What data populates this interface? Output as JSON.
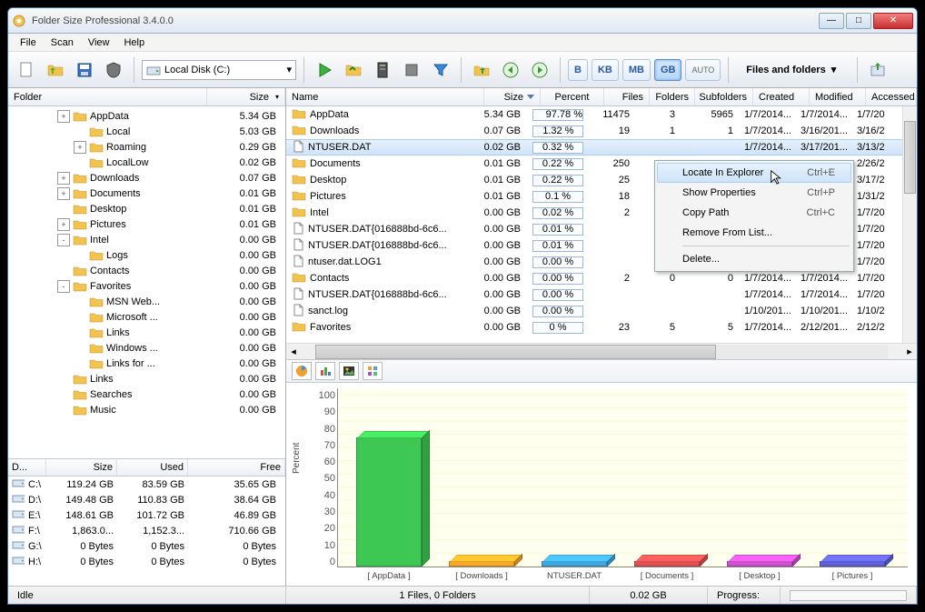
{
  "window": {
    "title": "Folder Size Professional 3.4.0.0"
  },
  "menu": {
    "file": "File",
    "scan": "Scan",
    "view": "View",
    "help": "Help"
  },
  "toolbar": {
    "drive_label": "Local Disk (C:)",
    "units": {
      "b": "B",
      "kb": "KB",
      "mb": "MB",
      "gb": "GB",
      "auto": "AUTO"
    },
    "filter_label": "Files and folders"
  },
  "tree": {
    "hdr_folder": "Folder",
    "hdr_size": "Size",
    "rows": [
      {
        "depth": 3,
        "exp": "+",
        "name": "AppData",
        "size": "5.34 GB",
        "icon": "folder"
      },
      {
        "depth": 4,
        "exp": "",
        "name": "Local",
        "size": "5.03 GB",
        "icon": "folder"
      },
      {
        "depth": 4,
        "exp": "+",
        "name": "Roaming",
        "size": "0.29 GB",
        "icon": "folder"
      },
      {
        "depth": 4,
        "exp": "",
        "name": "LocalLow",
        "size": "0.02 GB",
        "icon": "folder"
      },
      {
        "depth": 3,
        "exp": "+",
        "name": "Downloads",
        "size": "0.07 GB",
        "icon": "downloads"
      },
      {
        "depth": 3,
        "exp": "+",
        "name": "Documents",
        "size": "0.01 GB",
        "icon": "documents"
      },
      {
        "depth": 3,
        "exp": "",
        "name": "Desktop",
        "size": "0.01 GB",
        "icon": "desktop"
      },
      {
        "depth": 3,
        "exp": "+",
        "name": "Pictures",
        "size": "0.01 GB",
        "icon": "pictures"
      },
      {
        "depth": 3,
        "exp": "-",
        "name": "Intel",
        "size": "0.00 GB",
        "icon": "folder"
      },
      {
        "depth": 4,
        "exp": "",
        "name": "Logs",
        "size": "0.00 GB",
        "icon": "folder"
      },
      {
        "depth": 3,
        "exp": "",
        "name": "Contacts",
        "size": "0.00 GB",
        "icon": "contacts"
      },
      {
        "depth": 3,
        "exp": "-",
        "name": "Favorites",
        "size": "0.00 GB",
        "icon": "favorites"
      },
      {
        "depth": 4,
        "exp": "",
        "name": "MSN Web...",
        "size": "0.00 GB",
        "icon": "folder"
      },
      {
        "depth": 4,
        "exp": "",
        "name": "Microsoft ...",
        "size": "0.00 GB",
        "icon": "folder"
      },
      {
        "depth": 4,
        "exp": "",
        "name": "Links",
        "size": "0.00 GB",
        "icon": "folder"
      },
      {
        "depth": 4,
        "exp": "",
        "name": "Windows ...",
        "size": "0.00 GB",
        "icon": "folder"
      },
      {
        "depth": 4,
        "exp": "",
        "name": "Links for ...",
        "size": "0.00 GB",
        "icon": "folder"
      },
      {
        "depth": 3,
        "exp": "",
        "name": "Links",
        "size": "0.00 GB",
        "icon": "links"
      },
      {
        "depth": 3,
        "exp": "",
        "name": "Searches",
        "size": "0.00 GB",
        "icon": "searches"
      },
      {
        "depth": 3,
        "exp": "",
        "name": "Music",
        "size": "0.00 GB",
        "icon": "music"
      }
    ]
  },
  "disks": {
    "hdr": {
      "drive": "D...",
      "size": "Size",
      "used": "Used",
      "free": "Free"
    },
    "rows": [
      {
        "d": "C:\\",
        "size": "119.24 GB",
        "used": "83.59 GB",
        "free": "35.65 GB"
      },
      {
        "d": "D:\\",
        "size": "149.48 GB",
        "used": "110.83 GB",
        "free": "38.64 GB"
      },
      {
        "d": "E:\\",
        "size": "148.61 GB",
        "used": "101.72 GB",
        "free": "46.89 GB"
      },
      {
        "d": "F:\\",
        "size": "1,863.0...",
        "used": "1,152.3...",
        "free": "710.66 GB"
      },
      {
        "d": "G:\\",
        "size": "0 Bytes",
        "used": "0 Bytes",
        "free": "0 Bytes"
      },
      {
        "d": "H:\\",
        "size": "0 Bytes",
        "used": "0 Bytes",
        "free": "0 Bytes"
      }
    ]
  },
  "list": {
    "hdr": {
      "name": "Name",
      "size": "Size",
      "pct": "Percent",
      "files": "Files",
      "folders": "Folders",
      "subf": "Subfolders",
      "created": "Created",
      "modified": "Modified",
      "accessed": "Accessed"
    },
    "rows": [
      {
        "icon": "folder",
        "name": "AppData",
        "size": "5.34 GB",
        "pct": "97.78 %",
        "pfill": 97.78,
        "files": "11475",
        "folders": "3",
        "subf": "5965",
        "cr": "1/7/2014...",
        "mo": "1/7/2014...",
        "ac": "1/7/20"
      },
      {
        "icon": "folder",
        "name": "Downloads",
        "size": "0.07 GB",
        "pct": "1.32 %",
        "pfill": 1.32,
        "files": "19",
        "folders": "1",
        "subf": "1",
        "cr": "1/7/2014...",
        "mo": "3/16/201...",
        "ac": "3/16/2"
      },
      {
        "icon": "file",
        "name": "NTUSER.DAT",
        "size": "0.02 GB",
        "pct": "0.32 %",
        "pfill": 0.32,
        "files": "",
        "folders": "",
        "subf": "",
        "cr": "1/7/2014...",
        "mo": "3/17/201...",
        "ac": "3/13/2",
        "sel": true
      },
      {
        "icon": "folder",
        "name": "Documents",
        "size": "0.01 GB",
        "pct": "0.22 %",
        "pfill": 0.22,
        "files": "250",
        "folders": "",
        "subf": "",
        "cr": "",
        "mo": "",
        "ac": "2/26/2"
      },
      {
        "icon": "folder",
        "name": "Desktop",
        "size": "0.01 GB",
        "pct": "0.22 %",
        "pfill": 0.22,
        "files": "25",
        "folders": "",
        "subf": "",
        "cr": "",
        "mo": "",
        "ac": "3/17/2"
      },
      {
        "icon": "folder",
        "name": "Pictures",
        "size": "0.01 GB",
        "pct": "0.1 %",
        "pfill": 0.1,
        "files": "18",
        "folders": "",
        "subf": "",
        "cr": "",
        "mo": "",
        "ac": "1/31/2"
      },
      {
        "icon": "folder",
        "name": "Intel",
        "size": "0.00 GB",
        "pct": "0.02 %",
        "pfill": 0.02,
        "files": "2",
        "folders": "",
        "subf": "",
        "cr": "",
        "mo": "",
        "ac": "1/7/20"
      },
      {
        "icon": "file",
        "name": "NTUSER.DAT{016888bd-6c6...",
        "size": "0.00 GB",
        "pct": "0.01 %",
        "pfill": 0.01,
        "files": "",
        "folders": "",
        "subf": "",
        "cr": "",
        "mo": "",
        "ac": "1/7/20"
      },
      {
        "icon": "file",
        "name": "NTUSER.DAT{016888bd-6c6...",
        "size": "0.00 GB",
        "pct": "0.01 %",
        "pfill": 0.01,
        "files": "",
        "folders": "",
        "subf": "",
        "cr": "",
        "mo": "",
        "ac": "1/7/20"
      },
      {
        "icon": "file",
        "name": "ntuser.dat.LOG1",
        "size": "0.00 GB",
        "pct": "0.00 %",
        "pfill": 0,
        "files": "",
        "folders": "",
        "subf": "",
        "cr": "",
        "mo": "",
        "ac": "1/7/20"
      },
      {
        "icon": "folder",
        "name": "Contacts",
        "size": "0.00 GB",
        "pct": "0.00 %",
        "pfill": 0,
        "files": "2",
        "folders": "0",
        "subf": "0",
        "cr": "1/7/2014...",
        "mo": "1/7/2014...",
        "ac": "1/7/20"
      },
      {
        "icon": "file",
        "name": "NTUSER.DAT{016888bd-6c6...",
        "size": "0.00 GB",
        "pct": "0.00 %",
        "pfill": 0,
        "files": "",
        "folders": "",
        "subf": "",
        "cr": "1/7/2014...",
        "mo": "1/7/2014...",
        "ac": "1/7/20"
      },
      {
        "icon": "file",
        "name": "sanct.log",
        "size": "0.00 GB",
        "pct": "0.00 %",
        "pfill": 0,
        "files": "",
        "folders": "",
        "subf": "",
        "cr": "1/10/201...",
        "mo": "1/10/201...",
        "ac": "1/10/2"
      },
      {
        "icon": "folder",
        "name": "Favorites",
        "size": "0.00 GB",
        "pct": "0 %",
        "pfill": 0,
        "files": "23",
        "folders": "5",
        "subf": "5",
        "cr": "1/7/2014...",
        "mo": "2/12/201...",
        "ac": "2/12/2"
      }
    ]
  },
  "ctx": {
    "locate": "Locate In Explorer",
    "locate_sc": "Ctrl+E",
    "props": "Show Properties",
    "props_sc": "Ctrl+P",
    "copy": "Copy Path",
    "copy_sc": "Ctrl+C",
    "remove": "Remove From List...",
    "delete": "Delete..."
  },
  "chart_data": {
    "type": "bar",
    "ylabel": "Percent",
    "ylim": [
      0,
      100
    ],
    "yticks": [
      0,
      10,
      20,
      30,
      40,
      50,
      60,
      70,
      80,
      90,
      100
    ],
    "categories": [
      "[ AppData ]",
      "[ Downloads ]",
      "NTUSER.DAT",
      "[ Documents ]",
      "[ Desktop ]",
      "[ Pictures ]"
    ],
    "values": [
      97.78,
      1.32,
      0.32,
      0.22,
      0.22,
      0.1
    ],
    "colors": [
      "#3cc853",
      "#f9a826",
      "#3fa8e0",
      "#e05050",
      "#d050d0",
      "#6060d8"
    ]
  },
  "status": {
    "idle": "Idle",
    "sel": "1 Files, 0 Folders",
    "size": "0.02 GB",
    "progress": "Progress:"
  }
}
